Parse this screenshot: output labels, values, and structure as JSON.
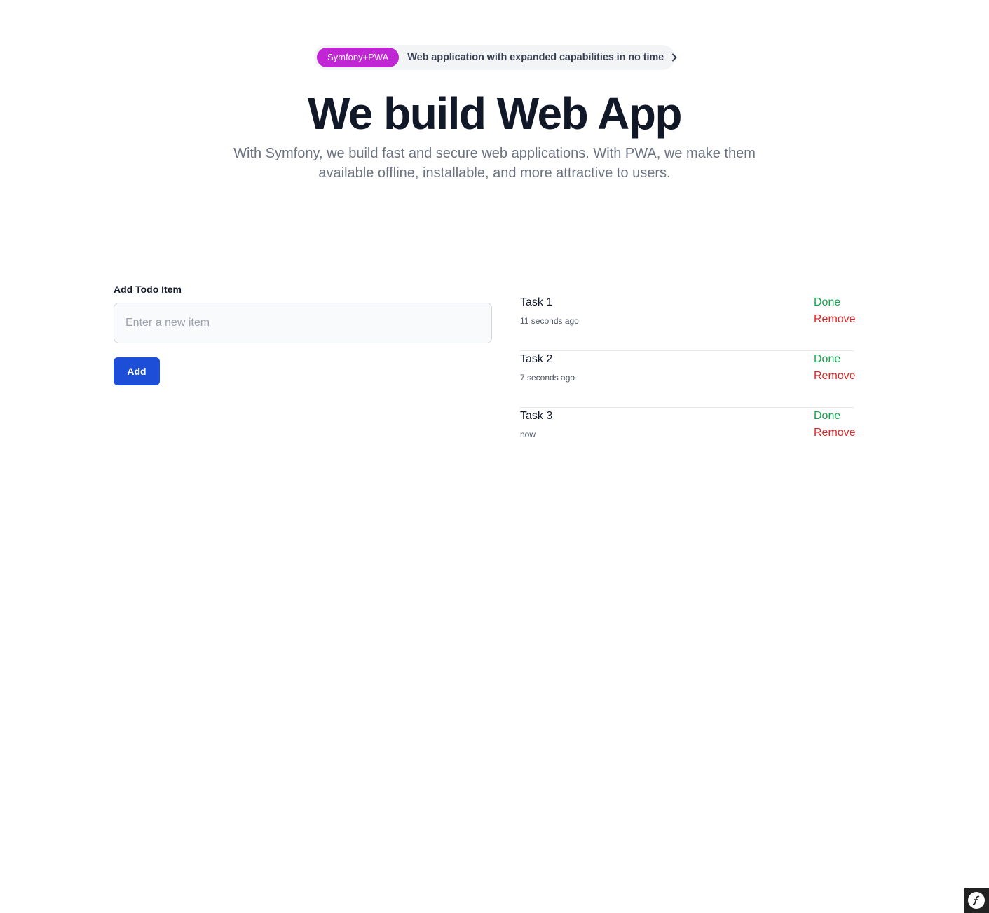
{
  "announcement": {
    "badge": "Symfony+PWA",
    "text": "Web application with expanded capabilities in no time",
    "chevron_icon": "chevron-right-icon"
  },
  "hero": {
    "title": "We build Web App",
    "subtitle": "With Symfony, we build fast and secure web applications. With PWA, we make them available offline, installable, and more attractive to users."
  },
  "form": {
    "label": "Add Todo Item",
    "input_value": "",
    "input_placeholder": "Enter a new item",
    "add_label": "Add"
  },
  "tasks": [
    {
      "name": "Task 1",
      "time": "11 seconds ago",
      "done_label": "Done",
      "remove_label": "Remove"
    },
    {
      "name": "Task 2",
      "time": "7 seconds ago",
      "done_label": "Done",
      "remove_label": "Remove"
    },
    {
      "name": "Task 3",
      "time": "now",
      "done_label": "Done",
      "remove_label": "Remove"
    }
  ],
  "colors": {
    "badge": "#c026d3",
    "primary_button": "#1d4ed8",
    "done": "#16a34a",
    "remove": "#dc2626"
  },
  "debug_toolbar": {
    "icon": "symfony-logo-icon"
  }
}
